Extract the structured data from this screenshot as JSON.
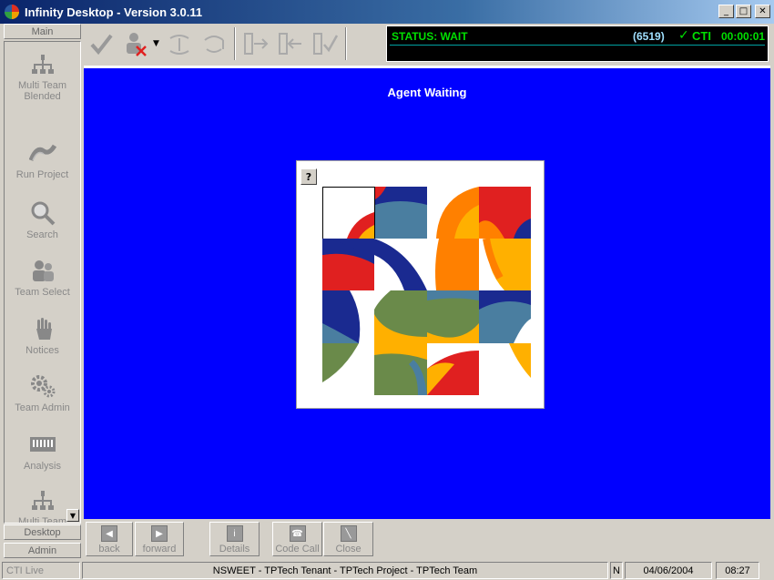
{
  "window": {
    "title": "Infinity Desktop - Version 3.0.11",
    "minimize": "_",
    "maximize": "□",
    "close": "✕"
  },
  "sidebar": {
    "top_tab": "Main",
    "items": [
      {
        "label": "Multi Team Blended",
        "icon": "org-chart-icon"
      },
      {
        "label": "Run Project",
        "icon": "run-project-icon"
      },
      {
        "label": "Search",
        "icon": "magnifier-icon"
      },
      {
        "label": "Team Select",
        "icon": "people-icon"
      },
      {
        "label": "Notices",
        "icon": "hand-icon"
      },
      {
        "label": "Team Admin",
        "icon": "gears-icon"
      },
      {
        "label": "Analysis",
        "icon": "chart-icon"
      },
      {
        "label": "Multi Team Verifier",
        "icon": "org-chart-icon"
      }
    ],
    "bottom_tabs": [
      "Desktop",
      "Admin"
    ]
  },
  "toolbar": {
    "buttons": [
      "check-icon",
      "user-remove-icon",
      "call-link-icon",
      "call-transfer-icon",
      "phone-arrow-right-icon",
      "phone-arrow-left-icon",
      "phone-check-icon"
    ]
  },
  "status": {
    "label": "STATUS: WAIT",
    "extension": "(6519)",
    "cti_check": "✓",
    "cti": "CTI",
    "timer": "00:00:01"
  },
  "main": {
    "title": "Agent Waiting",
    "help_label": "?"
  },
  "actions": [
    {
      "label": "back",
      "glyph": "◀"
    },
    {
      "label": "forward",
      "glyph": "▶"
    },
    {
      "label": "Details",
      "glyph": "i"
    },
    {
      "label": "Code Call",
      "glyph": "☎"
    },
    {
      "label": "Close",
      "glyph": "╲"
    }
  ],
  "statusbar": {
    "mode": "CTI Live",
    "context": "NSWEET - TPTech Tenant - TPTech Project - TPTech Team",
    "flag": "N",
    "date": "04/06/2004",
    "time": "08:27"
  },
  "colors": {
    "main_bg": "#0000ff",
    "status_green": "#00e000",
    "title_bar": "#0a246a"
  }
}
